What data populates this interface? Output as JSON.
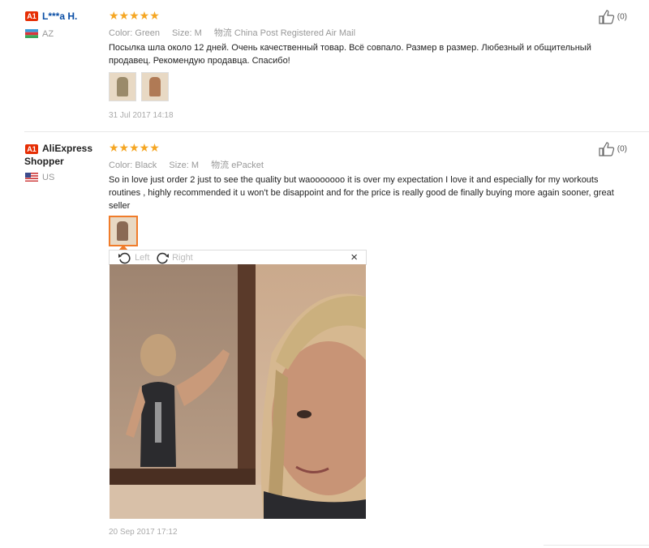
{
  "reviews": [
    {
      "badge": "A1",
      "user": "L***a H.",
      "country": "AZ",
      "stars": "★★★★★",
      "color_label": "Color:",
      "color_value": "Green",
      "size_label": "Size:",
      "size_value": "M",
      "shipping_label": "物流",
      "shipping_value": "China Post Registered Air Mail",
      "text": "Посылка шла около 12 дней. Очень качественный товар. Всё совпало. Размер в размер. Любезный и общительный продавец. Рекомендую продавца. Спасибо!",
      "date": "31 Jul 2017 14:18",
      "likes": "(0)"
    },
    {
      "badge": "A1",
      "user": "AliExpress Shopper",
      "country": "US",
      "stars": "★★★★★",
      "color_label": "Color:",
      "color_value": "Black",
      "size_label": "Size:",
      "size_value": "M",
      "shipping_label": "物流",
      "shipping_value": "ePacket",
      "text": "So in love just order 2 just to see the quality but waooooooo it is over my expectation I love it and especially for my workouts routines , highly recommended it u won't be disappoint and for the price is really good de finally buying more again sooner, great seller",
      "date": "20 Sep 2017 17:12",
      "likes": "(0)"
    }
  ],
  "viewer": {
    "left_label": "Left",
    "right_label": "Right",
    "close": "×"
  },
  "colors": {
    "accent": "#e62e04",
    "stars": "#f5a623",
    "link": "#0b4fa6"
  }
}
